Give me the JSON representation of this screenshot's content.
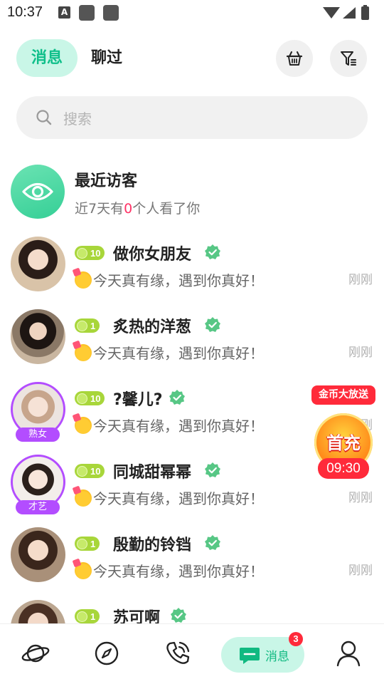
{
  "status_bar": {
    "time": "10:37",
    "a_icon_label": "A"
  },
  "header": {
    "tabs": [
      {
        "label": "消息",
        "active": true
      },
      {
        "label": "聊过",
        "active": false
      }
    ],
    "actions": [
      {
        "icon": "basket-icon"
      },
      {
        "icon": "filter-icon"
      }
    ]
  },
  "search": {
    "placeholder": "搜索"
  },
  "visitors": {
    "title": "最近访客",
    "sub_prefix": "近7天有",
    "count": "0",
    "sub_suffix": "个人看了你"
  },
  "conversations": [
    {
      "level": "10",
      "name": "做你女朋友",
      "message": "今天真有缘，遇到你真好！",
      "time": "刚刚",
      "tag": ""
    },
    {
      "level": "1",
      "name": "炙热的洋葱",
      "message": "今天真有缘，遇到你真好！",
      "time": "刚刚",
      "tag": ""
    },
    {
      "level": "10",
      "name": "?馨儿?",
      "message": "今天真有缘，遇到你真好！",
      "time": "刚刚",
      "tag": "熟女"
    },
    {
      "level": "10",
      "name": "同城甜幂幂",
      "message": "今天真有缘，遇到你真好！",
      "time": "刚刚",
      "tag": "才艺"
    },
    {
      "level": "1",
      "name": "殷勤的铃铛",
      "message": "今天真有缘，遇到你真好！",
      "time": "刚刚",
      "tag": ""
    },
    {
      "level": "1",
      "name": "苏可啊",
      "message": "",
      "time": "",
      "tag": ""
    }
  ],
  "promo": {
    "banner": "金币大放送",
    "title": "首充",
    "timer": "09:30"
  },
  "bottom_nav": {
    "items": [
      {
        "icon": "planet-icon"
      },
      {
        "icon": "compass-icon"
      },
      {
        "icon": "phone-call-icon"
      },
      {
        "icon": "message-icon",
        "label": "消息",
        "badge": "3",
        "active": true
      },
      {
        "icon": "profile-icon"
      }
    ]
  },
  "colors": {
    "accent": "#10b981",
    "accent_bg": "#c9f6e7",
    "badge": "#ff2a3a",
    "tag": "#b34dff"
  }
}
